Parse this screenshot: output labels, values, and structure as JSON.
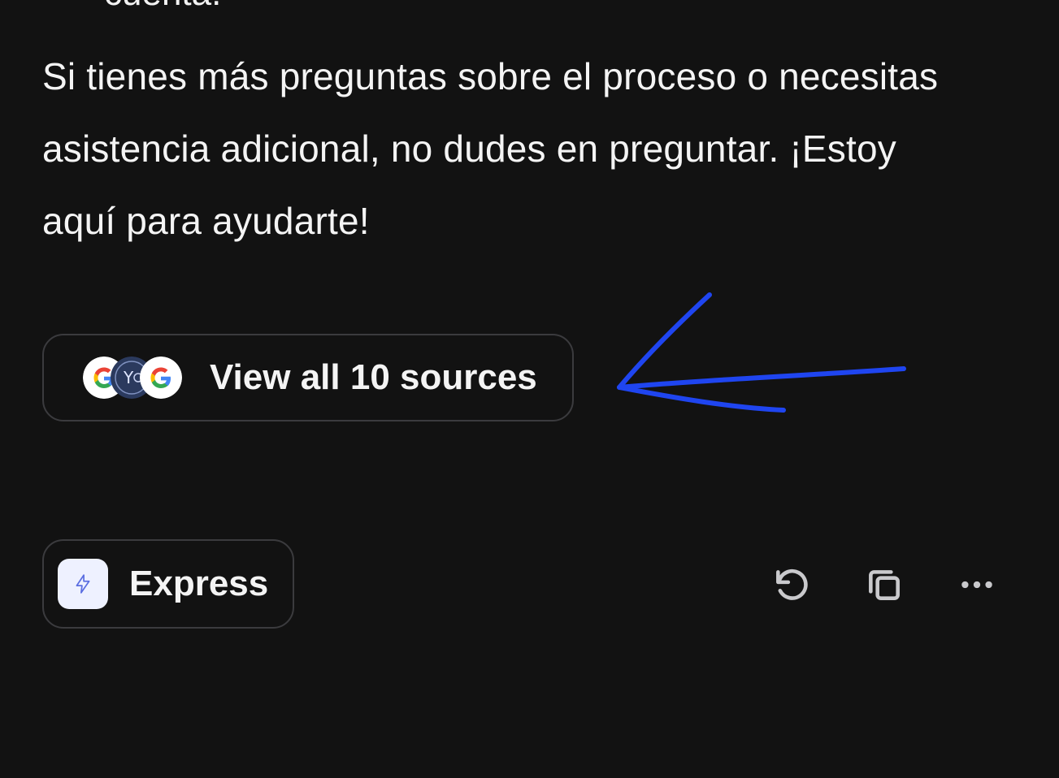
{
  "message": {
    "top_fragment": "cuenta.",
    "paragraph": "Si tienes más preguntas sobre el proceso o necesitas asistencia adicional, no dudes en preguntar. ¡Estoy aquí para ayudarte!"
  },
  "sources": {
    "button_label": "View all 10 sources",
    "icons": [
      "google-icon",
      "yc-icon",
      "google-icon"
    ],
    "yc_icon_text": "Y"
  },
  "mode": {
    "label": "Express",
    "icon": "lightning-icon",
    "icon_bg_color": "#eef1ff",
    "icon_color": "#5b6ee1"
  },
  "actions": {
    "icons": [
      "retry-icon",
      "copy-icon",
      "more-icon"
    ]
  },
  "annotation": {
    "arrow_color": "#1f45f0",
    "icon": "hand-drawn-arrow"
  },
  "theme": {
    "background": "#121212",
    "text": "#f4f4f4",
    "border": "#3b3b3e"
  }
}
